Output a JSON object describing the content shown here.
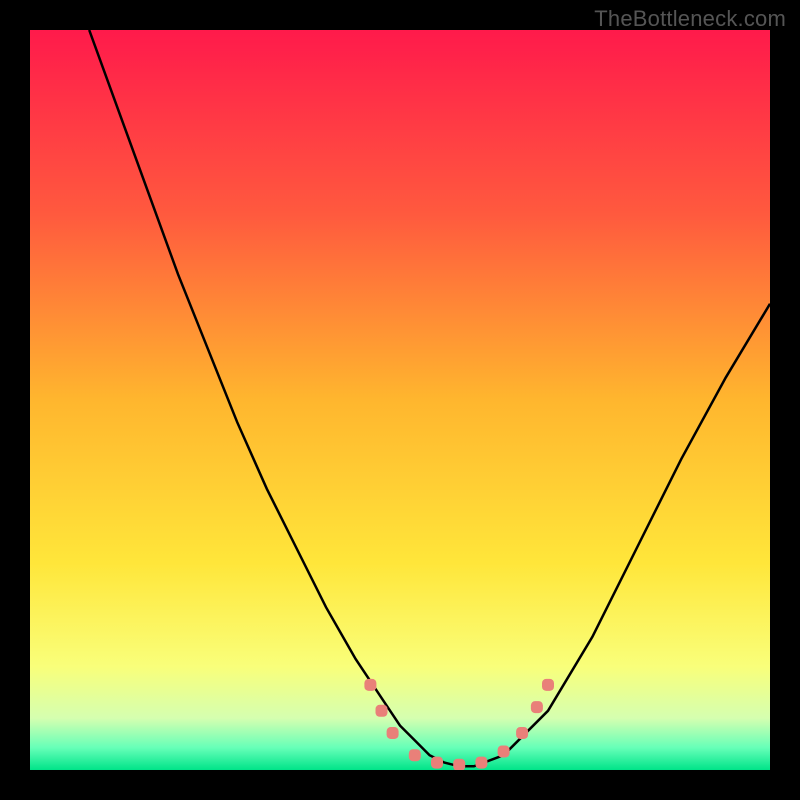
{
  "attribution": "TheBottleneck.com",
  "colors": {
    "frame": "#000000",
    "curve": "#000000",
    "marker_fill": "#e98079",
    "gradient_stops": [
      {
        "offset": 0.0,
        "color": "#ff1a4b"
      },
      {
        "offset": 0.25,
        "color": "#ff5a3e"
      },
      {
        "offset": 0.5,
        "color": "#ffb62e"
      },
      {
        "offset": 0.72,
        "color": "#ffe63a"
      },
      {
        "offset": 0.86,
        "color": "#f9ff7a"
      },
      {
        "offset": 0.93,
        "color": "#d5ffb0"
      },
      {
        "offset": 0.97,
        "color": "#66ffb8"
      },
      {
        "offset": 1.0,
        "color": "#00e489"
      }
    ]
  },
  "chart_data": {
    "type": "line",
    "title": "",
    "xlabel": "",
    "ylabel": "",
    "xlim": [
      0,
      100
    ],
    "ylim": [
      0,
      100
    ],
    "series": [
      {
        "name": "curve",
        "x": [
          8,
          12,
          16,
          20,
          24,
          28,
          32,
          36,
          40,
          44,
          46,
          48,
          50,
          52,
          54,
          56,
          58,
          60,
          64,
          70,
          76,
          82,
          88,
          94,
          100
        ],
        "values": [
          100,
          89,
          78,
          67,
          57,
          47,
          38,
          30,
          22,
          15,
          12,
          9,
          6,
          4,
          2,
          1,
          0.5,
          0.5,
          2,
          8,
          18,
          30,
          42,
          53,
          63
        ]
      }
    ],
    "markers": [
      {
        "x": 46.0,
        "y": 11.5
      },
      {
        "x": 47.5,
        "y": 8.0
      },
      {
        "x": 49.0,
        "y": 5.0
      },
      {
        "x": 52.0,
        "y": 2.0
      },
      {
        "x": 55.0,
        "y": 1.0
      },
      {
        "x": 58.0,
        "y": 0.7
      },
      {
        "x": 61.0,
        "y": 1.0
      },
      {
        "x": 64.0,
        "y": 2.5
      },
      {
        "x": 66.5,
        "y": 5.0
      },
      {
        "x": 68.5,
        "y": 8.5
      },
      {
        "x": 70.0,
        "y": 11.5
      }
    ],
    "marker_size_px": 12
  }
}
